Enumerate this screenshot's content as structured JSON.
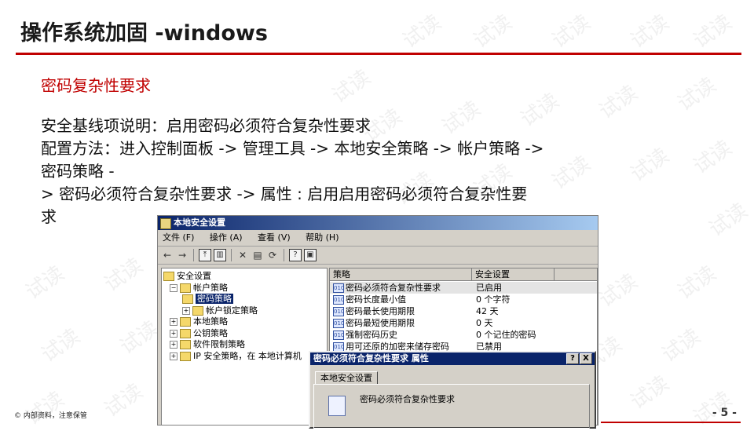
{
  "slide": {
    "title": "操作系统加固 -windows",
    "subtitle": "密码复杂性要求",
    "lines": [
      "安全基线项说明：启用密码必须符合复杂性要求",
      "配置方法：进入控制面板 -> 管理工具 -> 本地安全策略 -> 帐户策略 ->",
      "密码策略 -",
      "> 密码必须符合复杂性要求 -> 属性 : 启用启用密码必须符合复杂性要",
      "求"
    ],
    "footer_left": "© 内部资料，注意保管",
    "page_number": "- 5 -",
    "watermark": "试读"
  },
  "window": {
    "title": "本地安全设置",
    "menu": [
      "文件 (F)",
      "操作 (A)",
      "查看 (V)",
      "帮助 (H)"
    ],
    "toolbar_icons": [
      "back-arrow-icon",
      "forward-arrow-icon",
      "up-folder-icon",
      "show-tree-icon",
      "delete-icon",
      "properties-icon",
      "refresh-icon",
      "help-icon",
      "console-icon"
    ],
    "tree": [
      {
        "label": "安全设置",
        "level": 0,
        "expander": ""
      },
      {
        "label": "帐户策略",
        "level": 1,
        "expander": "−"
      },
      {
        "label": "密码策略",
        "level": 2,
        "expander": "",
        "selected": true
      },
      {
        "label": "帐户锁定策略",
        "level": 2,
        "expander": "+"
      },
      {
        "label": "本地策略",
        "level": 1,
        "expander": "+"
      },
      {
        "label": "公钥策略",
        "level": 1,
        "expander": "+"
      },
      {
        "label": "软件限制策略",
        "level": 1,
        "expander": "+"
      },
      {
        "label": "IP 安全策略，在 本地计算机",
        "level": 1,
        "expander": "+"
      }
    ],
    "list_headers": {
      "policy": "策略",
      "setting": "安全设置"
    },
    "rows": [
      {
        "policy": "密码必须符合复杂性要求",
        "setting": "已启用"
      },
      {
        "policy": "密码长度最小值",
        "setting": "0 个字符"
      },
      {
        "policy": "密码最长使用期限",
        "setting": "42 天"
      },
      {
        "policy": "密码最短使用期限",
        "setting": "0 天"
      },
      {
        "policy": "强制密码历史",
        "setting": "0 个记住的密码"
      },
      {
        "policy": "用可还原的加密来储存密码",
        "setting": "已禁用"
      }
    ]
  },
  "dialog": {
    "title": "密码必须符合复杂性要求 属性",
    "help_btn": "?",
    "close_btn": "X",
    "tab": "本地安全设置",
    "label": "密码必须符合复杂性要求"
  },
  "colors": {
    "accent": "#c00000",
    "titlebar": "#0a246a"
  }
}
